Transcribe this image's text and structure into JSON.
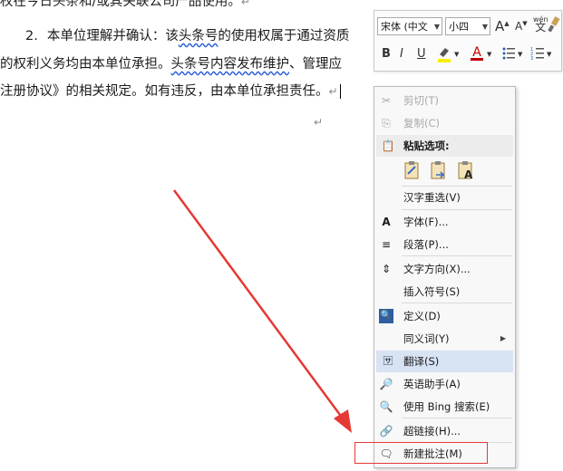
{
  "document": {
    "line1": "权在今日头条和/或其关联公司产品使用。",
    "line2_num": "2.",
    "line2": "本单位理解并确认：该",
    "line2_wavy": "头条号",
    "line2_rest": "的使用权属于通过资质",
    "line3_a": "的权利义务均由本单位承担。",
    "line3_wavy": "头条号内容发布维护",
    "line3_rest": "、管理应",
    "line4": "注册协议》的相关规定。如有违反，由本单位承担责任。",
    "para_mark": "↵"
  },
  "mini_toolbar": {
    "font_name": "宋体 (中文",
    "font_size": "小四",
    "grow_font": "A",
    "shrink_font": "A",
    "phonetic": "wén",
    "bold": "B",
    "italic": "I",
    "underline": "U",
    "font_color": "A"
  },
  "context_menu": {
    "cut": "剪切(T)",
    "copy": "复制(C)",
    "paste_options": "粘贴选项:",
    "reconvert": "汉字重选(V)",
    "font": "字体(F)...",
    "paragraph": "段落(P)...",
    "text_direction": "文字方向(X)...",
    "insert_symbol": "插入符号(S)",
    "define": "定义(D)",
    "synonyms": "同义词(Y)",
    "translate": "翻译(S)",
    "english_assistant": "英语助手(A)",
    "bing_search": "使用 Bing 搜索(E)",
    "hyperlink": "超链接(H)...",
    "new_comment": "新建批注(M)"
  },
  "colors": {
    "highlight": "#d7e2f3",
    "annotation_red": "#e53935",
    "wavy_underline": "#2b5fd9"
  }
}
